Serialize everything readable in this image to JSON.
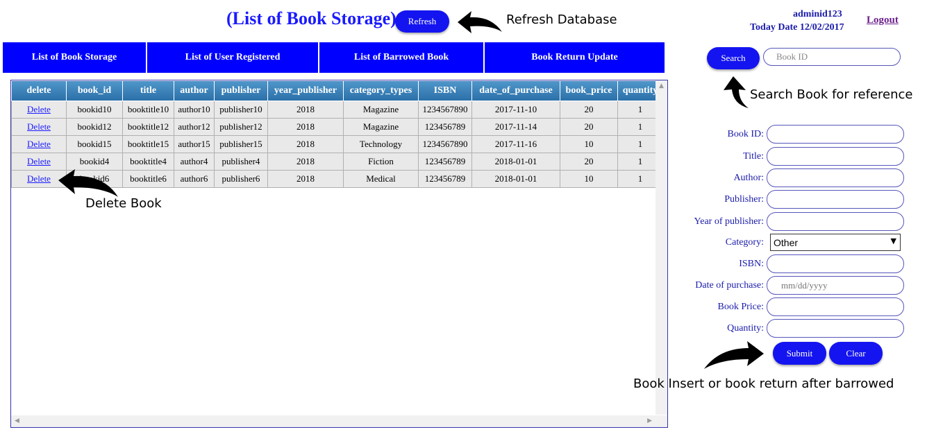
{
  "header": {
    "title": "(List of Book Storage)",
    "refresh_label": "Refresh",
    "refresh_annotation": "Refresh Database",
    "user_id": "adminid123",
    "today_date": "Today Date 12/02/2017",
    "logout_label": "Logout"
  },
  "nav": {
    "tabs": [
      {
        "label": "List of Book Storage"
      },
      {
        "label": "List of User Registered"
      },
      {
        "label": "List of Barrowed Book"
      },
      {
        "label": "Book Return Update"
      }
    ]
  },
  "table": {
    "columns": [
      "delete",
      "book_id",
      "title",
      "author",
      "publisher",
      "year_publisher",
      "category_types",
      "ISBN",
      "date_of_purchase",
      "book_price",
      "quantity"
    ],
    "rows": [
      {
        "delete": "Delete",
        "book_id": "bookid10",
        "title": "booktitle10",
        "author": "author10",
        "publisher": "publisher10",
        "year_publisher": "2018",
        "category_types": "Magazine",
        "isbn": "1234567890",
        "date_of_purchase": "2017-11-10",
        "book_price": "20",
        "quantity": "1"
      },
      {
        "delete": "Delete",
        "book_id": "bookid12",
        "title": "booktitle12",
        "author": "author12",
        "publisher": "publisher12",
        "year_publisher": "2018",
        "category_types": "Magazine",
        "isbn": "123456789",
        "date_of_purchase": "2017-11-14",
        "book_price": "20",
        "quantity": "1"
      },
      {
        "delete": "Delete",
        "book_id": "bookid15",
        "title": "booktitle15",
        "author": "author15",
        "publisher": "publisher15",
        "year_publisher": "2018",
        "category_types": "Technology",
        "isbn": "1234567890",
        "date_of_purchase": "2017-11-16",
        "book_price": "10",
        "quantity": "1"
      },
      {
        "delete": "Delete",
        "book_id": "bookid4",
        "title": "booktitle4",
        "author": "author4",
        "publisher": "publisher4",
        "year_publisher": "2018",
        "category_types": "Fiction",
        "isbn": "123456789",
        "date_of_purchase": "2018-01-01",
        "book_price": "20",
        "quantity": "1"
      },
      {
        "delete": "Delete",
        "book_id": "bookid6",
        "title": "booktitle6",
        "author": "author6",
        "publisher": "publisher6",
        "year_publisher": "2018",
        "category_types": "Medical",
        "isbn": "123456789",
        "date_of_purchase": "2018-01-01",
        "book_price": "10",
        "quantity": "1"
      }
    ],
    "delete_annotation": "Delete Book"
  },
  "search": {
    "button_label": "Search",
    "placeholder": "Book ID",
    "annotation": "Search Book for reference"
  },
  "form": {
    "book_id_label": "Book ID:",
    "title_label": "Title:",
    "author_label": "Author:",
    "publisher_label": "Publisher:",
    "year_label": "Year of publisher:",
    "category_label": "Category:",
    "category_value": "Other",
    "isbn_label": "ISBN:",
    "date_label": "Date of purchase:",
    "date_placeholder": "mm/dd/yyyy",
    "price_label": "Book Price:",
    "quantity_label": "Quantity:",
    "submit_label": "Submit",
    "clear_label": "Clear",
    "annotation": "Book Insert or book return after barrowed"
  },
  "colors": {
    "accent_blue": "#0000ff",
    "header_gradient_top": "#4f96c9",
    "header_gradient_bottom": "#2a6fa8",
    "label_blue": "#1a1aaa"
  }
}
